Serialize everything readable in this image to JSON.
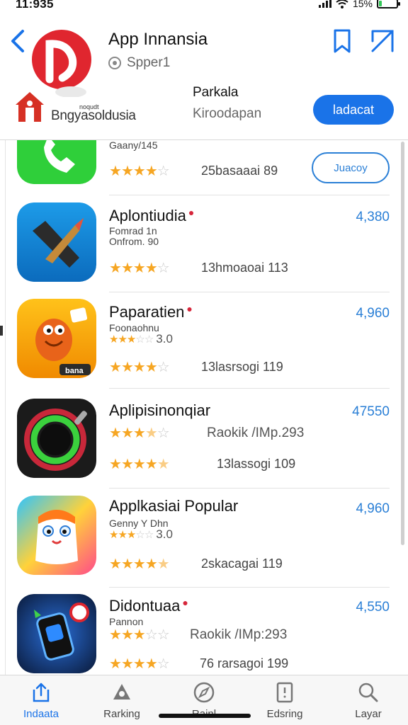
{
  "status": {
    "time": "11:935",
    "battery": "15%",
    "battery_level": 0.15
  },
  "header": {
    "title": "App Innansia",
    "subtitle": "Spper1",
    "developer": "Bngyasoldusia",
    "developer_label": "noqudt",
    "category_label": "Parkala",
    "category_sub": "Kiroodapan",
    "button_label": "ladacat"
  },
  "apps": [
    {
      "name": "",
      "meta": "Gaany/145",
      "price": "",
      "button_label": "Juacoy",
      "rating": 4,
      "reviews": "25basaaai 89",
      "icon": "phone-icon"
    },
    {
      "name": "Aplontiudia",
      "meta": "Fomrad 1n\nOnfrom. 90",
      "price": "4,380",
      "rating": 4,
      "reviews": "13hmoaoai 113",
      "icon": "pencil-icon"
    },
    {
      "name": "Paparatien",
      "meta": "Foonaohnu",
      "small_rating": "3.0",
      "price": "4,960",
      "rating": 4,
      "reviews": "13lasrsogi 119",
      "icon": "fox-icon",
      "icon_caption": "bana"
    },
    {
      "name": "Aplipisinonqiar",
      "price": "47550",
      "mid_text": "Raokik /IMp.293",
      "rating": 4.5,
      "reviews": "13lassogi 109",
      "icon": "ring-icon"
    },
    {
      "name": "Applkasiai Popular",
      "meta": "Genny Y Dhn",
      "small_rating": "3.0",
      "price": "4,960",
      "rating": 4.5,
      "reviews": "2skacagai 119",
      "icon": "mascot-icon"
    },
    {
      "name": "Didontuaa",
      "meta": "Pannon",
      "price": "4,550",
      "mid_text": "Raokik /IMp:293",
      "rating": 4,
      "reviews": "76 rarsagoi 199",
      "icon": "phone-shield-icon"
    }
  ],
  "tabs": [
    {
      "label": "Indaata",
      "icon": "upload-icon",
      "active": true
    },
    {
      "label": "Rarking",
      "icon": "ranking-icon"
    },
    {
      "label": "Rainl",
      "icon": "compass-icon"
    },
    {
      "label": "Edsring",
      "icon": "document-icon"
    },
    {
      "label": "Layar",
      "icon": "search-icon"
    }
  ],
  "colors": {
    "accent": "#1a73e8",
    "price": "#2a7fd6",
    "star": "#f6a623",
    "logo": "#e0262f"
  }
}
